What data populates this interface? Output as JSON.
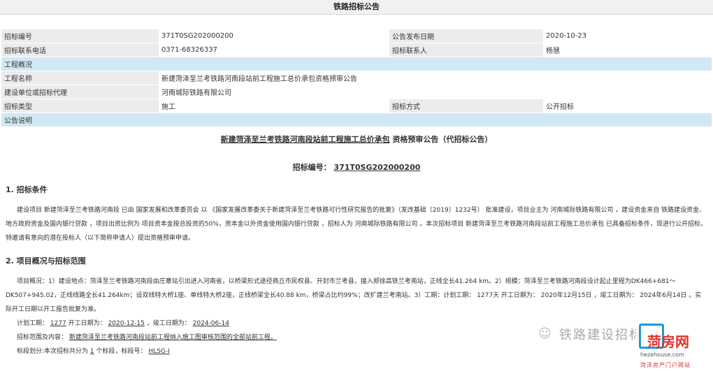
{
  "page_title": "铁路招标公告",
  "info": {
    "row1": {
      "l1": "招标编号",
      "v1": "371T0SG202000200",
      "l2": "公告发布日期",
      "v2": "2020-10-23"
    },
    "row2": {
      "l1": "招标联系电话",
      "v1": "0371-68326337",
      "l2": "招标联系人",
      "v2": "杨慧"
    },
    "sec1": "工程概况",
    "row3": {
      "l1": "工程名称",
      "v1": "新建菏泽至兰考铁路河南段站前工程施工总价承包资格预审公告"
    },
    "row4": {
      "l1": "建设单位或招标代理",
      "v1": "河南城际铁路有限公司"
    },
    "row5": {
      "l1": "招标类型",
      "v1": "施工",
      "l2": "招标方式",
      "v2": "公开招标"
    },
    "sec2": "公告说明"
  },
  "doc": {
    "title_u": "新建菏泽至兰考铁路河南段站前工程施工总价承包",
    "title_rest": "资格预审公告（代招标公告）",
    "tender_label": "招标编号：",
    "tender_no": "371T0SG202000200",
    "h1": "1. 招标条件",
    "p1": "建设项目 新建菏泽至兰考铁路河南段 已由 国家发展和改革委员会 以 《国家发展改革委关于新建菏泽至兰考铁路可行性研究报告的批复》（发改基础〔2019〕1232号） 批准建设，项目业主为 河南城际铁路有限公司 ，建设资金来自 铁路建设资金、地方政府资金及国内银行贷款 ，项目出资比例为 项目资本金按总投资的50%，资本金以外资金使用国内银行贷款 ，招标人为 河南城际铁路有限公司 。本次招标项目 新建菏泽至兰考铁路河南段站前工程施工总价承包 已具备招标条件，现进行公开招标，特邀请有意向的潜在投标人（以下简称申请人）提出资格预审申请。",
    "h2": "2. 项目概况与招标范围",
    "p2": "项目概况：1）建设地点：菏泽至兰考铁路河南段由庄寨站引出进入河南省，以桥梁形式途径商丘市民权县、开封市兰考县，接入郑徐高铁兰考南站，正线全长41.264 km。2）规模：菏泽至兰考铁路河南段设计起止里程为DK466+681～DK507+945.02，正线线路全长41.264km；设双线特大桥1座、单线特大桥2座，正线桥梁全长40.88 km，桥梁占比约99%；改扩建兰考南站。3）工期：计划工期： 1277天 开工日期为： 2020年12月15日 ，竣工日期为： 2024年6月14日 。实际开工日期以开工报告批复为准。",
    "plan_label": "计划工期：",
    "plan_val": "1277",
    "start_label": "开工日期为：",
    "start_val": "2020-12-15",
    "end_label": "，竣工日期为：",
    "end_val": "2024-06-14",
    "scope_label": "招标范围及内容：",
    "scope_val": "新建菏泽至兰考铁路河南段站前工程纳入施工图审核范围的全部站前工程。",
    "lot_text_a": "标段划分:本次招标共分为",
    "lot_count": "1",
    "lot_text_b": "个标段，标段号：",
    "lot_no": "HLSG-I"
  },
  "watermark": {
    "text": "铁路建设招标",
    "logo_main": "菏房网",
    "logo_site": "hezehouse.com",
    "logo_sub": "菏泽房产门户网站"
  }
}
